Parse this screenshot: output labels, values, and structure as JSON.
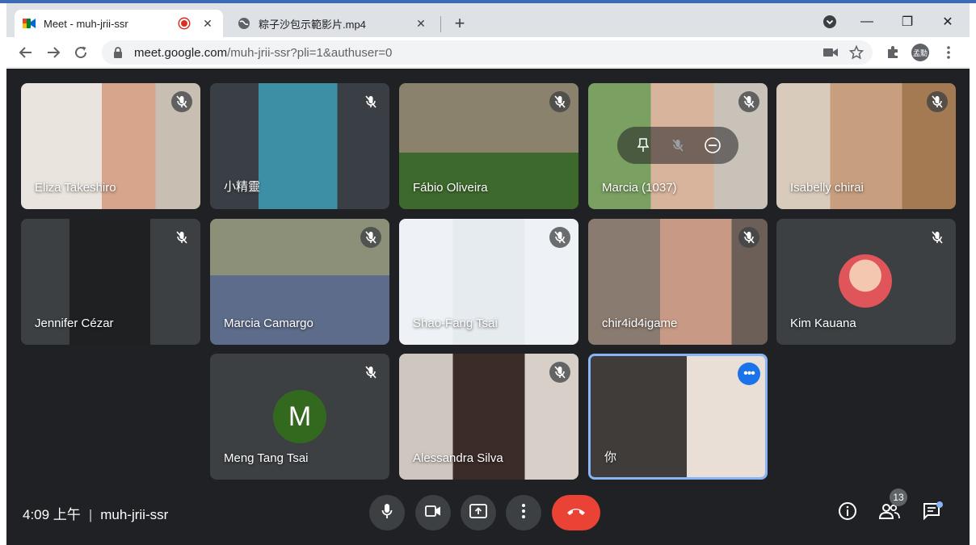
{
  "browser": {
    "tabs": [
      {
        "title": "Meet - muh-jrii-ssr",
        "active": true,
        "recording": true
      },
      {
        "title": "粽子沙包示範影片.mp4",
        "active": false,
        "recording": false
      }
    ],
    "close_glyph": "✕",
    "new_tab_glyph": "+",
    "window_controls": [
      "—",
      "❐",
      "✕"
    ],
    "url_host": "meet.google.com",
    "url_path": "/muh-jrii-ssr?pli=1&authuser=0",
    "profile_label": "孟勳"
  },
  "meeting": {
    "participants": [
      {
        "name": "Eliza Takeshiro",
        "muted": true,
        "bg": "#c9b8a6"
      },
      {
        "name": "小精靈",
        "muted": true,
        "bg": "#3a3f45"
      },
      {
        "name": "Fábio Oliveira",
        "muted": true,
        "bg": "#7b6f55"
      },
      {
        "name": "Marcia (1037)",
        "muted": true,
        "bg": "#6f8a5c"
      },
      {
        "name": "Isabelly chirai",
        "muted": true,
        "bg": "#b59a7b"
      },
      {
        "name": "Jennifer Cézar",
        "muted": true,
        "bg": "#2e2f31"
      },
      {
        "name": "Marcia Camargo",
        "muted": true,
        "bg": "#8b8f7a"
      },
      {
        "name": "Shao-Fang Tsai",
        "muted": true,
        "bg": "#e9eef3"
      },
      {
        "name": "chir4id4igame",
        "muted": true,
        "bg": "#7e6e62"
      },
      {
        "name": "Kim Kauana",
        "muted": true,
        "bg": "#3c4043"
      },
      {
        "name": "Meng Tang Tsai",
        "muted": true,
        "bg": "#3c4043",
        "initial": "M"
      },
      {
        "name": "Alessandra Silva",
        "muted": true,
        "bg": "#a37d72"
      },
      {
        "name": "你",
        "muted": false,
        "bg": "#4d4a47",
        "self": true
      }
    ],
    "time": "4:09 上午",
    "separator": "|",
    "meeting_code": "muh-jrii-ssr",
    "participant_count": "13",
    "more_glyph": "•••"
  },
  "colors": {
    "meet_bg": "#202124",
    "tile_bg": "#3c4043",
    "hangup": "#ea4335",
    "self_border": "#8ab4f8",
    "accent": "#1a73e8"
  }
}
